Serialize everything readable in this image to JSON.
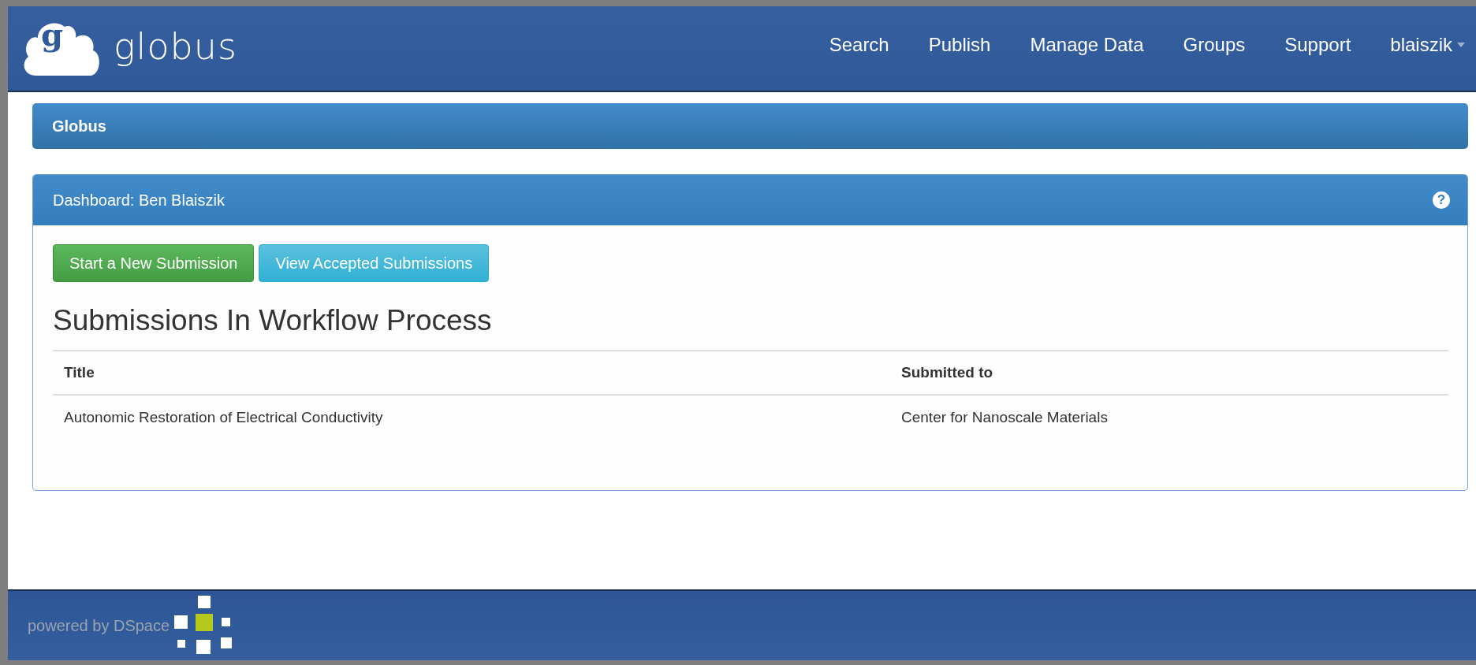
{
  "navbar": {
    "logo_letter": "g",
    "brand": "globus",
    "links": [
      {
        "label": "Search"
      },
      {
        "label": "Publish"
      },
      {
        "label": "Manage Data"
      },
      {
        "label": "Groups"
      },
      {
        "label": "Support"
      }
    ],
    "user_menu": {
      "label": "blaiszik"
    }
  },
  "breadcrumb": {
    "title": "Globus"
  },
  "dashboard": {
    "title": "Dashboard: Ben Blaiszik",
    "help": "?",
    "buttons": [
      {
        "label": "Start a New Submission",
        "kind": "success"
      },
      {
        "label": "View Accepted Submissions",
        "kind": "info"
      }
    ],
    "heading": "Submissions In Workflow Process",
    "table": {
      "columns": [
        "Title",
        "Submitted to"
      ],
      "rows": [
        [
          "Autonomic Restoration of Electrical Conductivity",
          "Center for Nanoscale Materials"
        ]
      ]
    }
  },
  "footer": {
    "text": "powered by DSpace"
  }
}
